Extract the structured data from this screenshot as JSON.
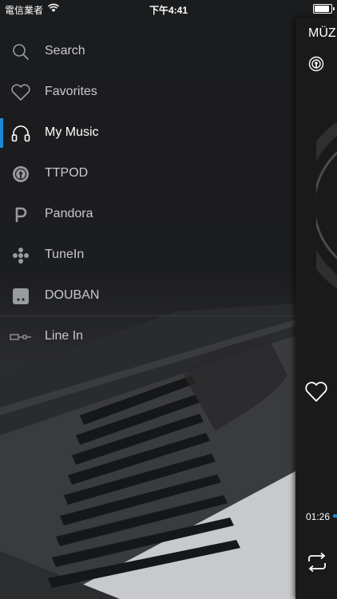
{
  "status_bar": {
    "carrier": "電信業者",
    "time": "下午4:41"
  },
  "sidebar": {
    "items": [
      {
        "label": "Search",
        "icon": "search-icon"
      },
      {
        "label": "Favorites",
        "icon": "heart-icon"
      },
      {
        "label": "My Music",
        "icon": "headphones-icon",
        "active": true
      },
      {
        "label": "TTPOD",
        "icon": "podcast-icon"
      },
      {
        "label": "Pandora",
        "icon": "pandora-icon"
      },
      {
        "label": "TuneIn",
        "icon": "tunein-icon"
      },
      {
        "label": "DOUBAN",
        "icon": "douban-icon"
      }
    ],
    "line_in": {
      "label": "Line In",
      "icon": "line-in-icon"
    }
  },
  "player": {
    "title": "MÜZ",
    "elapsed": "01:26"
  },
  "colors": {
    "accent": "#1e88d8",
    "menu_text": "#c9cacc"
  }
}
